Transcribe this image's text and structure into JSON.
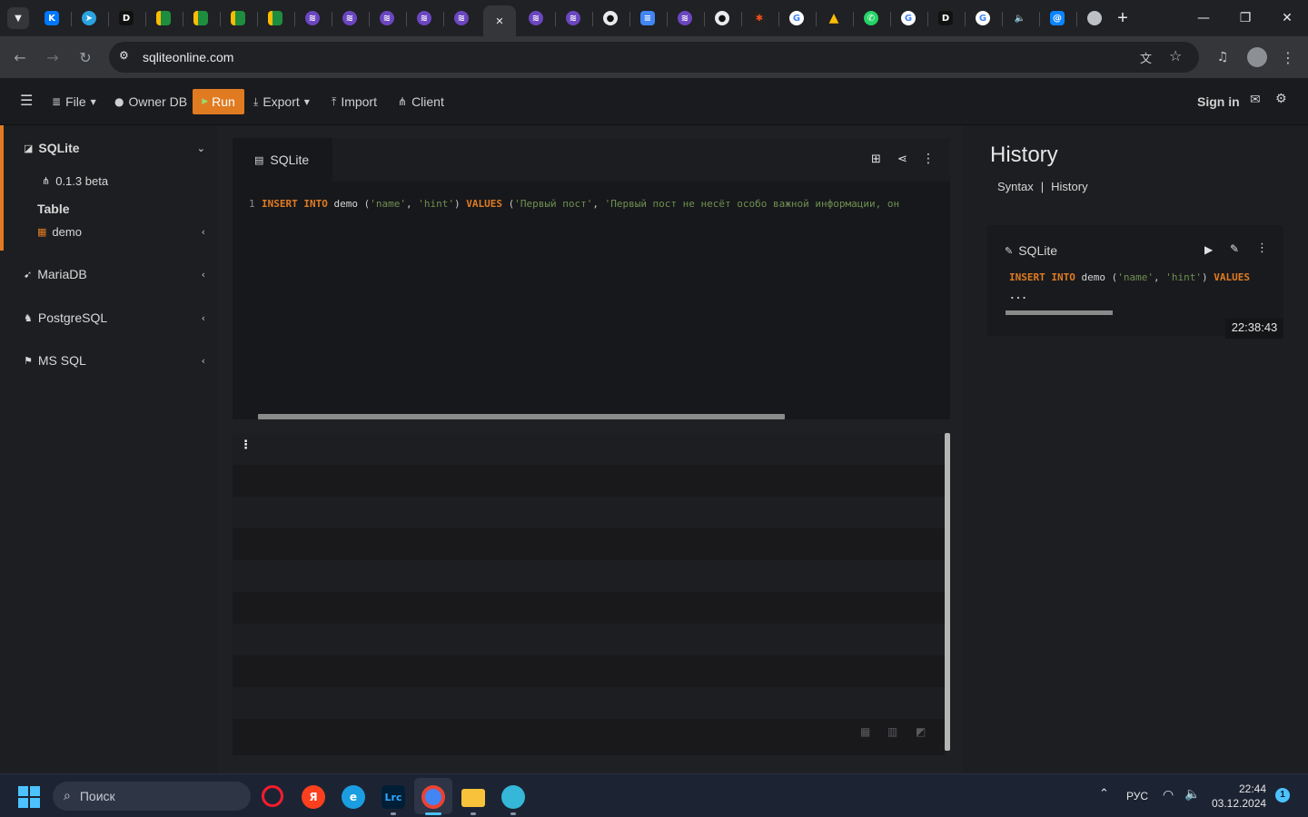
{
  "browser": {
    "active_tab_close": "✕",
    "new_tab": "+",
    "url": "sqliteonline.com",
    "window_buttons": {
      "minimize": "—",
      "maximize": "❐",
      "close": "✕"
    }
  },
  "app": {
    "menu": {
      "file": "File",
      "owner_db": "Owner DB",
      "run": "Run",
      "export": "Export",
      "import": "Import",
      "client": "Client"
    },
    "sign_in": "Sign in"
  },
  "sidebar": {
    "sqlite": {
      "label": "SQLite",
      "version": "0.1.3 beta",
      "section_title": "Table",
      "table": "demo"
    },
    "mariadb": "MariaDB",
    "postgresql": "PostgreSQL",
    "mssql": "MS SQL"
  },
  "editor": {
    "tab_label": "SQLite",
    "line_number": "1",
    "tokens": [
      {
        "t": "INSERT INTO",
        "c": "kw"
      },
      {
        "t": " demo ",
        "c": "id"
      },
      {
        "t": "(",
        "c": "pn"
      },
      {
        "t": "'name'",
        "c": "str"
      },
      {
        "t": ", ",
        "c": "pn"
      },
      {
        "t": "'hint'",
        "c": "str"
      },
      {
        "t": ") ",
        "c": "pn"
      },
      {
        "t": "VALUES",
        "c": "kw"
      },
      {
        "t": " (",
        "c": "pn"
      },
      {
        "t": "'Первый пост'",
        "c": "str"
      },
      {
        "t": ", ",
        "c": "pn"
      },
      {
        "t": "'Первый пост не несёт особо важной информации, он",
        "c": "str"
      }
    ]
  },
  "history": {
    "title": "History",
    "links": {
      "syntax": "Syntax",
      "separator": "|",
      "history": "History"
    },
    "entry": {
      "db": "SQLite",
      "query_tokens": [
        {
          "t": "INSERT INTO",
          "c": "kw"
        },
        {
          "t": " demo ",
          "c": "id"
        },
        {
          "t": "(",
          "c": "pn"
        },
        {
          "t": "'name'",
          "c": "str"
        },
        {
          "t": ", ",
          "c": "pn"
        },
        {
          "t": "'hint'",
          "c": "str"
        },
        {
          "t": ") ",
          "c": "pn"
        },
        {
          "t": "VALUES",
          "c": "kw"
        }
      ],
      "ellipsis": "...",
      "time": "22:38:43"
    }
  },
  "taskbar": {
    "search_placeholder": "Поиск",
    "lang": "РУС",
    "time": "22:44",
    "date": "03.12.2024",
    "notification_count": "1"
  },
  "colors": {
    "accent": "#e07b22",
    "keyword": "#e07b22",
    "string": "#6f8f51"
  }
}
